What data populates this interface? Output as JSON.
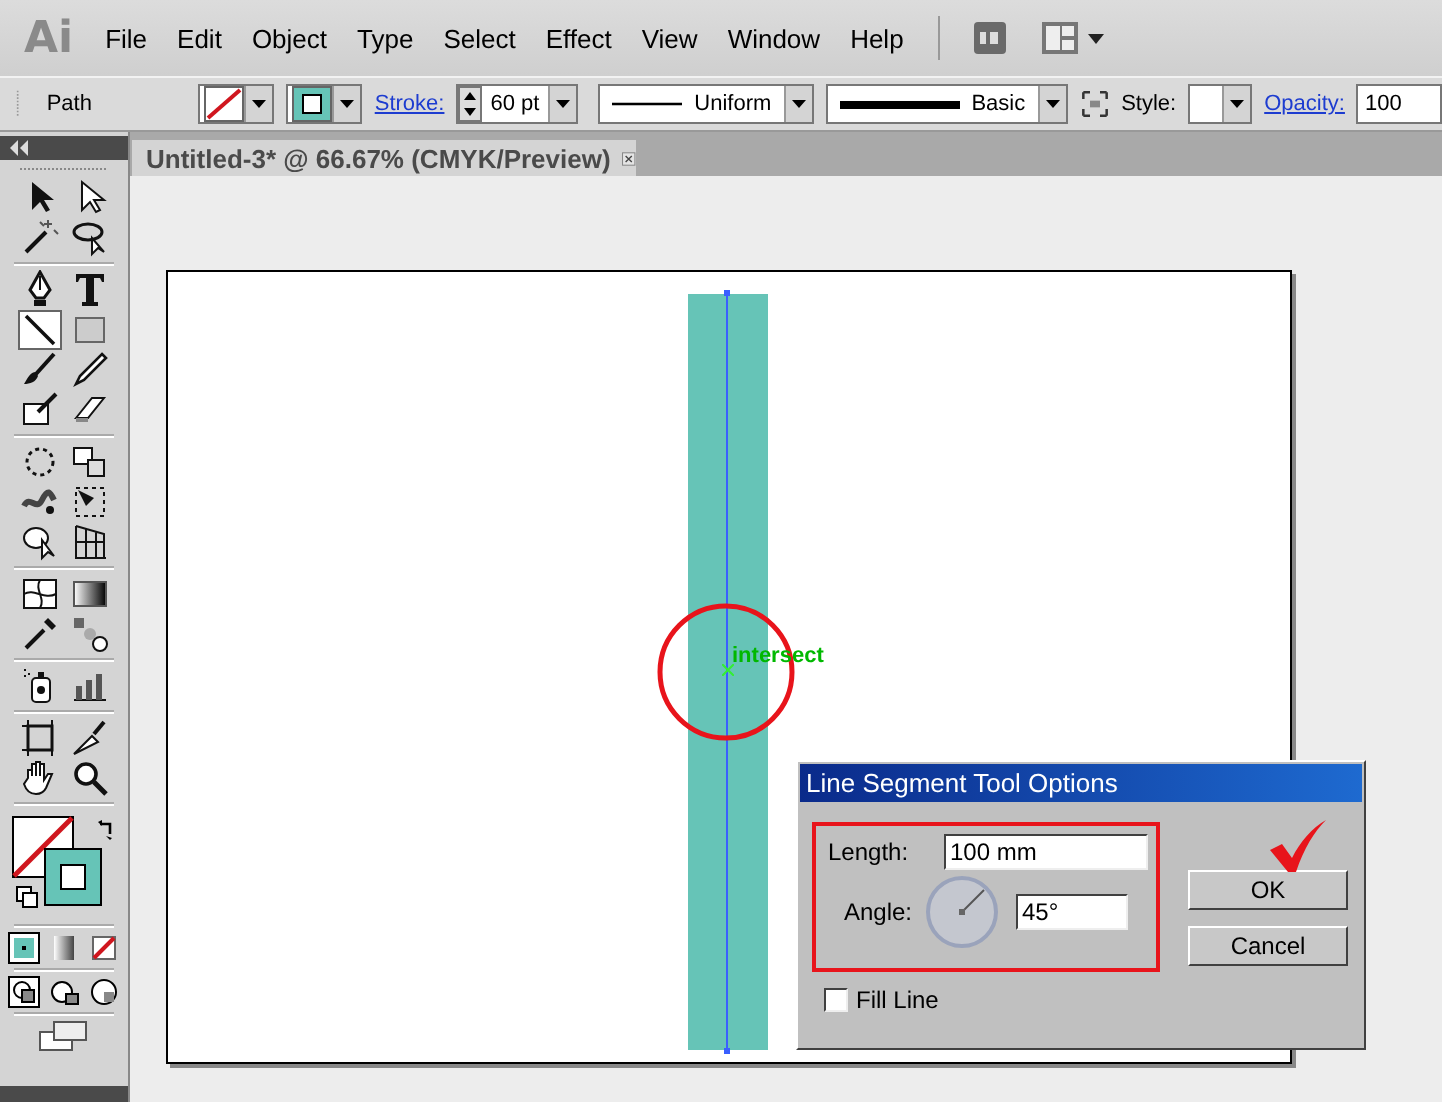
{
  "app": {
    "logo": "Ai"
  },
  "menu": [
    "File",
    "Edit",
    "Object",
    "Type",
    "Select",
    "Effect",
    "View",
    "Window",
    "Help"
  ],
  "control_bar": {
    "selection": "Path",
    "stroke_label": "Stroke:",
    "stroke_weight": "60 pt",
    "profile": "Uniform",
    "brush": "Basic",
    "style_label": "Style:",
    "opacity_label": "Opacity:",
    "opacity": "100"
  },
  "document_tab": {
    "title": "Untitled-3* @ 66.67% (CMYK/Preview)"
  },
  "tool_groups": [
    [
      {
        "kind": "selection",
        "selected": false
      },
      {
        "kind": "direct",
        "selected": false
      },
      {
        "kind": "wand",
        "selected": false
      },
      {
        "kind": "lasso",
        "selected": false
      }
    ],
    [
      {
        "kind": "pen",
        "selected": false
      },
      {
        "kind": "type",
        "selected": false
      },
      {
        "kind": "line",
        "selected": true
      },
      {
        "kind": "rect",
        "selected": false
      },
      {
        "kind": "brush",
        "selected": false
      },
      {
        "kind": "pencil",
        "selected": false
      },
      {
        "kind": "blob",
        "selected": false
      },
      {
        "kind": "eraser",
        "selected": false
      }
    ],
    [
      {
        "kind": "rotate",
        "selected": false
      },
      {
        "kind": "scale",
        "selected": false
      },
      {
        "kind": "warp",
        "selected": false
      },
      {
        "kind": "transform",
        "selected": false
      },
      {
        "kind": "builder",
        "selected": false
      },
      {
        "kind": "grid",
        "selected": false
      }
    ],
    [
      {
        "kind": "mesh",
        "selected": false
      },
      {
        "kind": "gradient",
        "selected": false
      },
      {
        "kind": "dropper",
        "selected": false
      },
      {
        "kind": "blend",
        "selected": false
      }
    ],
    [
      {
        "kind": "sprayer",
        "selected": false
      },
      {
        "kind": "graph",
        "selected": false
      }
    ],
    [
      {
        "kind": "artboard",
        "selected": false
      },
      {
        "kind": "slice",
        "selected": false
      },
      {
        "kind": "hand",
        "selected": false
      },
      {
        "kind": "zoom",
        "selected": false
      }
    ]
  ],
  "canvas": {
    "smart_guide": "intersect"
  },
  "dialog": {
    "title": "Line Segment Tool Options",
    "length_label": "Length:",
    "length": "100 mm",
    "angle_label": "Angle:",
    "angle": "45°",
    "fill_line": {
      "label": "Fill Line",
      "checked": false
    },
    "buttons": [
      "OK",
      "Cancel"
    ]
  }
}
